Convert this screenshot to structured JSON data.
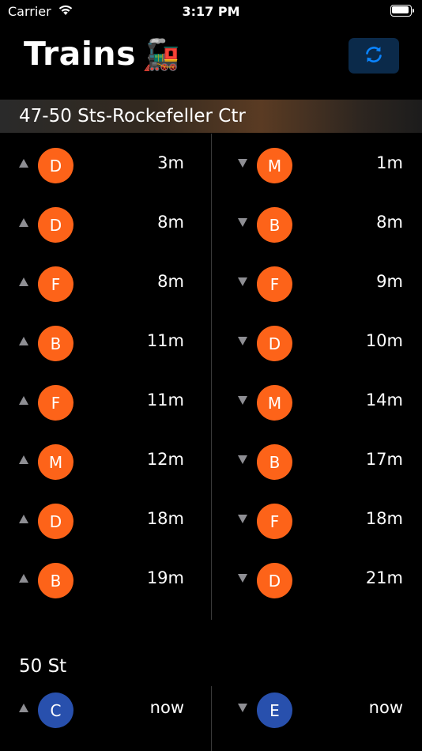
{
  "status_bar": {
    "carrier": "Carrier",
    "time": "3:17 PM"
  },
  "header": {
    "title": "Trains",
    "title_emoji": "🚂"
  },
  "colors": {
    "orange_line": "#fd6319",
    "blue_line": "#2850ad",
    "refresh_button_bg": "#0b2a4a",
    "refresh_icon": "#0a84ff"
  },
  "stations": [
    {
      "name": "47-50 Sts-Rockefeller Ctr",
      "uptown": [
        {
          "line": "D",
          "eta": "3m",
          "color": "#fd6319"
        },
        {
          "line": "D",
          "eta": "8m",
          "color": "#fd6319"
        },
        {
          "line": "F",
          "eta": "8m",
          "color": "#fd6319"
        },
        {
          "line": "B",
          "eta": "11m",
          "color": "#fd6319"
        },
        {
          "line": "F",
          "eta": "11m",
          "color": "#fd6319"
        },
        {
          "line": "M",
          "eta": "12m",
          "color": "#fd6319"
        },
        {
          "line": "D",
          "eta": "18m",
          "color": "#fd6319"
        },
        {
          "line": "B",
          "eta": "19m",
          "color": "#fd6319"
        }
      ],
      "downtown": [
        {
          "line": "M",
          "eta": "1m",
          "color": "#fd6319"
        },
        {
          "line": "B",
          "eta": "8m",
          "color": "#fd6319"
        },
        {
          "line": "F",
          "eta": "9m",
          "color": "#fd6319"
        },
        {
          "line": "D",
          "eta": "10m",
          "color": "#fd6319"
        },
        {
          "line": "M",
          "eta": "14m",
          "color": "#fd6319"
        },
        {
          "line": "B",
          "eta": "17m",
          "color": "#fd6319"
        },
        {
          "line": "F",
          "eta": "18m",
          "color": "#fd6319"
        },
        {
          "line": "D",
          "eta": "21m",
          "color": "#fd6319"
        }
      ]
    },
    {
      "name": "50 St",
      "uptown": [
        {
          "line": "C",
          "eta": "now",
          "color": "#2850ad"
        }
      ],
      "downtown": [
        {
          "line": "E",
          "eta": "now",
          "color": "#2850ad"
        }
      ]
    }
  ]
}
